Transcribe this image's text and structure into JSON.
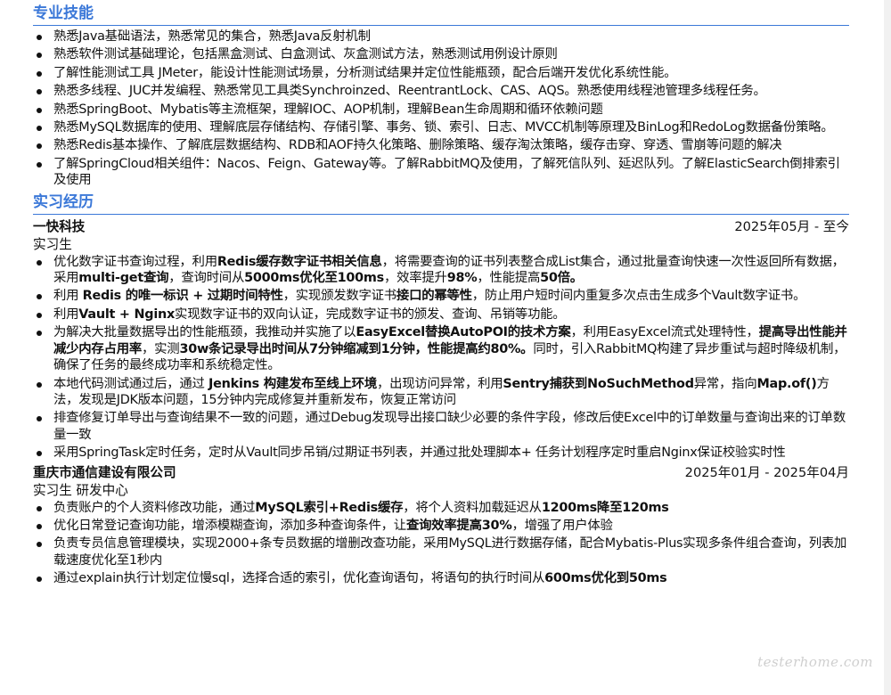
{
  "sections": {
    "skills": {
      "title": "专业技能",
      "items": [
        [
          {
            "t": "熟悉Java基础语法，熟悉常见的集合，熟悉Java反射机制",
            "b": false
          }
        ],
        [
          {
            "t": "熟悉软件测试基础理论，包括黑盒测试、白盒测试、灰盒测试方法，熟悉测试用例设计原则",
            "b": false
          }
        ],
        [
          {
            "t": "了解性能测试工具 JMeter，能设计性能测试场景，分析测试结果并定位性能瓶颈，配合后端开发优化系统性能。",
            "b": false
          }
        ],
        [
          {
            "t": "熟悉多线程、JUC并发编程、熟悉常见工具类Synchroinzed、ReentrantLock、CAS、AQS。熟悉使用线程池管理多线程任务。",
            "b": false
          }
        ],
        [
          {
            "t": "熟悉SpringBoot、Mybatis等主流框架，理解IOC、AOP机制，理解Bean生命周期和循环依赖问题",
            "b": false
          }
        ],
        [
          {
            "t": "熟悉MySQL数据库的使用、理解底层存储结构、存储引擎、事务、锁、索引、日志、MVCC机制等原理及BinLog和RedoLog数据备份策略。",
            "b": false
          }
        ],
        [
          {
            "t": "熟悉Redis基本操作、了解底层数据结构、RDB和AOF持久化策略、删除策略、缓存淘汰策略，缓存击穿、穿透、雪崩等问题的解决",
            "b": false
          }
        ],
        [
          {
            "t": "了解SpringCloud相关组件：Nacos、Feign、Gateway等。了解RabbitMQ及使用，了解死信队列、延迟队列。了解ElasticSearch倒排索引及使用",
            "b": false
          }
        ]
      ]
    },
    "internship": {
      "title": "实习经历",
      "jobs": [
        {
          "company": "一快科技",
          "date": "2025年05月 - 至今",
          "role": "实习生",
          "items": [
            [
              {
                "t": "优化数字证书查询过程，利用",
                "b": false
              },
              {
                "t": "Redis缓存数字证书相关信息",
                "b": true
              },
              {
                "t": "，将需要查询的证书列表整合成List集合，通过批量查询快速一次性返回所有数据，采用",
                "b": false
              },
              {
                "t": "multi-get查询",
                "b": true
              },
              {
                "t": "，查询时间从",
                "b": false
              },
              {
                "t": "5000ms优化至100ms",
                "b": true
              },
              {
                "t": "，效率提升",
                "b": false
              },
              {
                "t": "98%",
                "b": true
              },
              {
                "t": "，性能提高",
                "b": false
              },
              {
                "t": "50倍。",
                "b": true
              }
            ],
            [
              {
                "t": "利用 ",
                "b": false
              },
              {
                "t": "Redis 的唯一标识 + 过期时间特性",
                "b": true
              },
              {
                "t": "，实现颁发数字证书",
                "b": false
              },
              {
                "t": "接口的幂等性",
                "b": true
              },
              {
                "t": "，防止用户短时间内重复多次点击生成多个Vault数字证书。",
                "b": false
              }
            ],
            [
              {
                "t": "利用",
                "b": false
              },
              {
                "t": "Vault + Nginx",
                "b": true
              },
              {
                "t": "实现数字证书的双向认证，完成数字证书的颁发、查询、吊销等功能。",
                "b": false
              }
            ],
            [
              {
                "t": "为解决大批量数据导出的性能瓶颈，我推动并实施了以",
                "b": false
              },
              {
                "t": "EasyExcel替换AutoPOI的技术方案",
                "b": true
              },
              {
                "t": "，利用EasyExcel流式处理特性，",
                "b": false
              },
              {
                "t": "提高导出性能并减少内存占用率",
                "b": true
              },
              {
                "t": "，实测",
                "b": false
              },
              {
                "t": "30w条记录导出时间从7分钟缩减到1分钟，性能提高约80%。",
                "b": true
              },
              {
                "t": "同时，引入RabbitMQ构建了异步重试与超时降级机制，确保了任务的最终成功率和系统稳定性。",
                "b": false
              }
            ],
            [
              {
                "t": "本地代码测试通过后，通过 ",
                "b": false
              },
              {
                "t": "Jenkins 构建发布至线上环境",
                "b": true
              },
              {
                "t": "，出现访问异常，利用",
                "b": false
              },
              {
                "t": "Sentry捕获到NoSuchMethod",
                "b": true
              },
              {
                "t": "异常，指向",
                "b": false
              },
              {
                "t": "Map.of()",
                "b": true
              },
              {
                "t": "方法，发现是JDK版本问题，15分钟内完成修复并重新发布，恢复正常访问",
                "b": false
              }
            ],
            [
              {
                "t": "排查修复订单导出与查询结果不一致的问题，通过Debug发现导出接口缺少必要的条件字段，修改后使Excel中的订单数量与查询出来的订单数量一致",
                "b": false
              }
            ],
            [
              {
                "t": "采用SpringTask定时任务，定时从Vault同步吊销/过期证书列表，并通过批处理脚本+ 任务计划程序定时重启Nginx保证校验实时性",
                "b": false
              }
            ]
          ]
        },
        {
          "company": "重庆市通信建设有限公司",
          "date": "2025年01月 - 2025年04月",
          "role": "实习生 研发中心",
          "items": [
            [
              {
                "t": "负责账户的个人资料修改功能，通过",
                "b": false
              },
              {
                "t": "MySQL索引+Redis缓存",
                "b": true
              },
              {
                "t": "，将个人资料加载延迟从",
                "b": false
              },
              {
                "t": "1200ms降至120ms",
                "b": true
              }
            ],
            [
              {
                "t": "优化日常登记查询功能，增添模糊查询，添加多种查询条件，让",
                "b": false
              },
              {
                "t": "查询效率提高30%",
                "b": true
              },
              {
                "t": "，增强了用户体验",
                "b": false
              }
            ],
            [
              {
                "t": "负责专员信息管理模块，实现2000+条专员数据的增删改查功能，采用MySQL进行数据存储，配合Mybatis-Plus实现多条件组合查询，列表加载速度优化至1秒内",
                "b": false
              }
            ],
            [
              {
                "t": "通过explain执行计划定位慢sql，选择合适的索引，优化查询语句，将语句的执行时间从",
                "b": false
              },
              {
                "t": "600ms优化到50ms",
                "b": true
              }
            ]
          ]
        }
      ]
    }
  },
  "colors": {
    "accent": "#3b78d8",
    "text": "#111111"
  }
}
